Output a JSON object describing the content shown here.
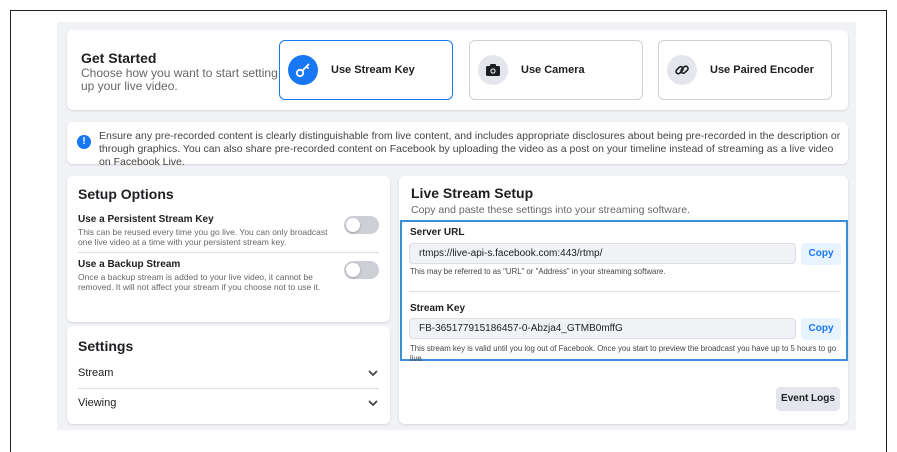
{
  "get_started": {
    "title": "Get Started",
    "description": "Choose how you want to start setting up your live video.",
    "options": [
      {
        "label": "Use Stream Key",
        "icon": "key-icon",
        "selected": true
      },
      {
        "label": "Use Camera",
        "icon": "camera-icon",
        "selected": false
      },
      {
        "label": "Use Paired Encoder",
        "icon": "link-icon",
        "selected": false
      }
    ]
  },
  "notice": {
    "icon": "info-icon",
    "text": "Ensure any pre-recorded content is clearly distinguishable from live content, and includes appropriate disclosures about being pre-recorded in the description or through graphics. You can also share pre-recorded content on Facebook by uploading the video as a post on your timeline instead of streaming as a live video on Facebook Live."
  },
  "setup_options": {
    "title": "Setup Options",
    "persistent": {
      "title": "Use a Persistent Stream Key",
      "description": "This can be reused every time you go live. You can only broadcast one live video at a time with your persistent stream key.",
      "enabled": false
    },
    "backup": {
      "title": "Use a Backup Stream",
      "description": "Once a backup stream is added to your live video, it cannot be removed. It will not affect your stream if you choose not to use it.",
      "enabled": false
    }
  },
  "settings": {
    "title": "Settings",
    "items": [
      {
        "label": "Stream"
      },
      {
        "label": "Viewing"
      }
    ]
  },
  "live_setup": {
    "title": "Live Stream Setup",
    "subtitle": "Copy and paste these settings into your streaming software.",
    "server_url": {
      "label": "Server URL",
      "value": "rtmps://live-api-s.facebook.com:443/rtmp/",
      "copy_label": "Copy",
      "hint": "This may be referred to as \"URL\" or \"Address\" in your streaming software."
    },
    "stream_key": {
      "label": "Stream Key",
      "value": "FB-365177915186457-0-Abzja4_GTMB0mffG",
      "copy_label": "Copy",
      "hint": "This stream key is valid until you log out of Facebook. Once you start to preview the broadcast you have up to 5 hours to go live."
    },
    "event_logs_label": "Event Logs"
  },
  "colors": {
    "accent": "#1877f2",
    "highlight_box": "#3a8fd8",
    "background": "#f0f2f5"
  }
}
